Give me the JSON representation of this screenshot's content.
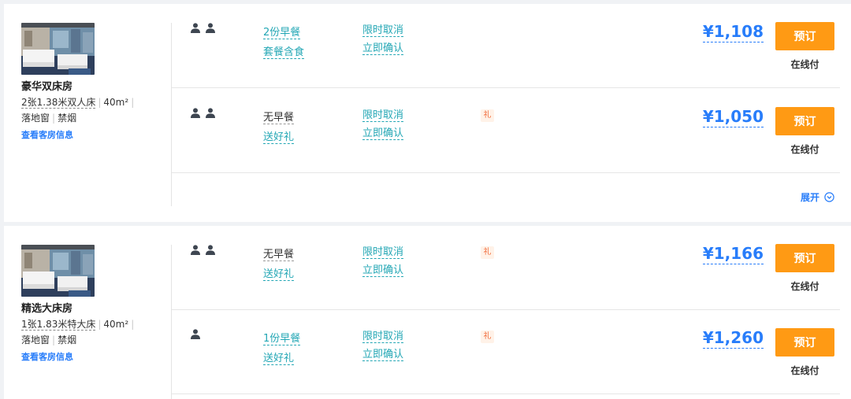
{
  "rooms": [
    {
      "name": "豪华双床房",
      "bed": "2张1.38米双人床",
      "area": "40m²",
      "window": "落地窗",
      "smoking": "禁烟",
      "info_link": "查看客房信息",
      "rates": [
        {
          "guests": 2,
          "meal_line1": "2份早餐",
          "meal_line2": "套餐含食",
          "cancel": "限时取消",
          "confirm": "立即确认",
          "gift": "",
          "price": "¥1,108",
          "book": "预订",
          "pay": "在线付"
        },
        {
          "guests": 2,
          "meal_line1": "无早餐",
          "meal_line2": "送好礼",
          "cancel": "限时取消",
          "confirm": "立即确认",
          "gift": "礼",
          "price": "¥1,050",
          "book": "预订",
          "pay": "在线付"
        }
      ],
      "expand_label": "展开"
    },
    {
      "name": "精选大床房",
      "bed": "1张1.83米特大床",
      "area": "40m²",
      "window": "落地窗",
      "smoking": "禁烟",
      "info_link": "查看客房信息",
      "rates": [
        {
          "guests": 2,
          "meal_line1": "无早餐",
          "meal_line2": "送好礼",
          "cancel": "限时取消",
          "confirm": "立即确认",
          "gift": "礼",
          "price": "¥1,166",
          "book": "预订",
          "pay": "在线付"
        },
        {
          "guests": 1,
          "meal_line1": "1份早餐",
          "meal_line2": "送好礼",
          "cancel": "限时取消",
          "confirm": "立即确认",
          "gift": "礼",
          "price": "¥1,260",
          "book": "预订",
          "pay": "在线付"
        }
      ]
    }
  ],
  "colors": {
    "accent": "#287dfa",
    "teal": "#24a7b5",
    "button": "#ff9a14",
    "gift": "#f26b3a"
  },
  "icons": {
    "guest": "person-icon",
    "expand": "chevron-down-circle-icon"
  }
}
